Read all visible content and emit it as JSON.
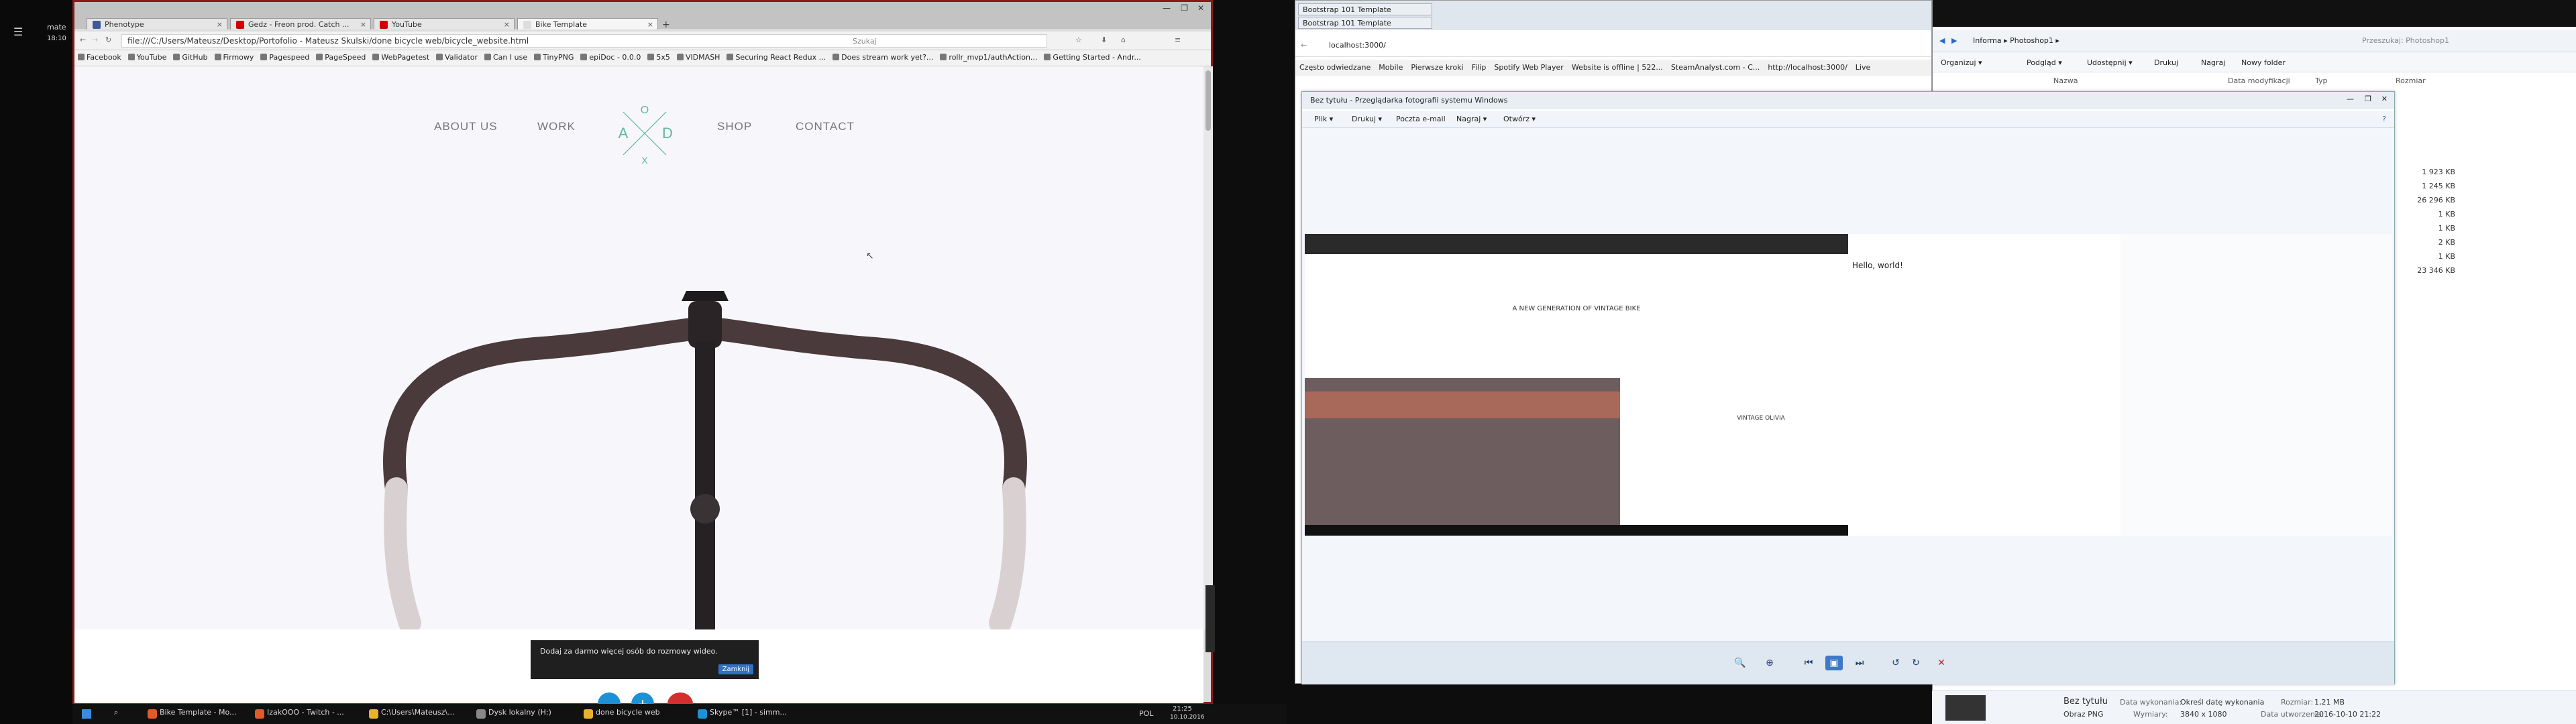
{
  "skype": {
    "name": "mate",
    "time": "18:10"
  },
  "chrome": {
    "tabs": [
      {
        "label": "Phenotype",
        "color": "#3b5998"
      },
      {
        "label": "Gedz - Freon prod. Catch ...",
        "color": "#cc0000"
      },
      {
        "label": "YouTube",
        "color": "#cc0000"
      },
      {
        "label": "Bike Template",
        "color": "#dddddd"
      }
    ],
    "address": "file:///C:/Users/Mateusz/Desktop/Portofolio - Mateusz Skulski/done bicycle web/bicycle_website.html",
    "search_placeholder": "Szukaj",
    "bookmarks": [
      "Facebook",
      "YouTube",
      "GitHub",
      "Firmowy",
      "Pagespeed",
      "PageSpeed",
      "WebPagetest",
      "Validator",
      "Can I use",
      "TinyPNG",
      "epiDoc - 0.0.0",
      "5x5",
      "VIDMASH",
      "Securing React Redux ...",
      "Does stream work yet?...",
      "rollr_mvp1/authAction...",
      "Getting Started - Andr..."
    ]
  },
  "site": {
    "nav": [
      "ABOUT US",
      "WORK",
      "SHOP",
      "CONTACT"
    ],
    "logo_letters": [
      "O",
      "A",
      "D",
      "X"
    ],
    "accent": "#5fb7a2"
  },
  "notification": {
    "text": "Dodaj za darmo więcej osób do rozmowy wideo.",
    "button": "Zamknij"
  },
  "taskbar": {
    "items": [
      {
        "label": "Bike Template - Mo...",
        "color": "#e05a2b"
      },
      {
        "label": "IzakOOO - Twitch - ...",
        "color": "#e05a2b"
      },
      {
        "label": "C:\\Users\\Mateusz\\...",
        "color": "#e8b32b"
      },
      {
        "label": "Dysk lokalny (H:)",
        "color": "#888888"
      },
      {
        "label": "done bicycle web",
        "color": "#e8b32b"
      },
      {
        "label": "Skype™ [1] - simm...",
        "color": "#1e90d6"
      }
    ],
    "lang": "POL",
    "time": "21:25",
    "date": "10.10.2016"
  },
  "ie": {
    "tabs": [
      "Bootstrap 101 Template",
      "Bootstrap 101 Template"
    ],
    "address": "localhost:3000/",
    "favorites": [
      "Często odwiedzane",
      "Mobile",
      "Pierwsze kroki",
      "Filip",
      "Spotify Web Player",
      "Website is offline | 522...",
      "SteamAnalyst.com - C...",
      "http://localhost:3000/",
      "Live"
    ]
  },
  "explorer": {
    "path": "Informa ▸ Photoshop1 ▸",
    "search_placeholder": "Przeszukaj: Photoshop1",
    "toolbar": [
      "Organizuj ▾",
      "Podgląd ▾",
      "Udostępnij ▾",
      "Drukuj",
      "Nagraj",
      "Nowy folder"
    ],
    "columns": [
      "Nazwa",
      "Data modyfikacji",
      "Typ",
      "Rozmiar"
    ],
    "sizes": [
      "1 923 KB",
      "1 245 KB",
      "26 296 KB",
      "1 KB",
      "1 KB",
      "2 KB",
      "1 KB",
      "23 346 KB"
    ],
    "details": {
      "name": "Bez tytułu",
      "type": "Obraz PNG",
      "date_taken_label": "Data wykonania:",
      "date_taken": "Określ datę wykonania",
      "dims_label": "Wymiary:",
      "dims": "3840 x 1080",
      "size_label": "Rozmiar:",
      "size": "1,21 MB",
      "created_label": "Data utworzenia:",
      "created": "2016-10-10 21:22"
    }
  },
  "viewer": {
    "title": "Bez tytułu - Przeglądarka fotografii systemu Windows",
    "menu": [
      "Plik ▾",
      "Drukuj ▾",
      "Poczta e-mail",
      "Nagraj ▾",
      "Otwórz ▾"
    ],
    "inner_heading": "A NEW GENERATION OF VINTAGE BIKE",
    "inner_sub": "VINTAGE OLIVIA",
    "hello": "Hello, world!"
  }
}
